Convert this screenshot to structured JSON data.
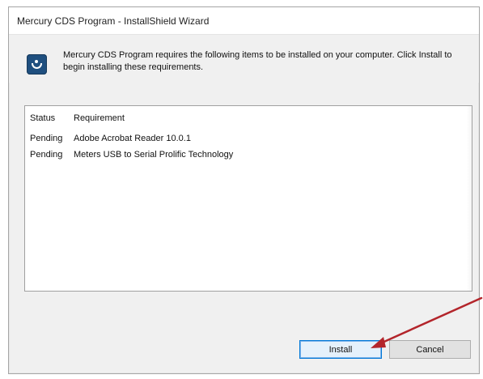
{
  "window": {
    "title": "Mercury CDS Program - InstallShield Wizard"
  },
  "header": {
    "icon": "installer-app-icon",
    "message": "Mercury CDS Program requires the following items to be installed on your computer. Click Install to begin installing these requirements."
  },
  "requirements": {
    "columns": {
      "status": "Status",
      "requirement": "Requirement"
    },
    "rows": [
      {
        "status": "Pending",
        "requirement": "Adobe Acrobat Reader 10.0.1"
      },
      {
        "status": "Pending",
        "requirement": "Meters USB to Serial Prolific Technology"
      }
    ]
  },
  "buttons": {
    "install": "Install",
    "cancel": "Cancel"
  },
  "annotation": {
    "arrow_color": "#b3252b"
  }
}
